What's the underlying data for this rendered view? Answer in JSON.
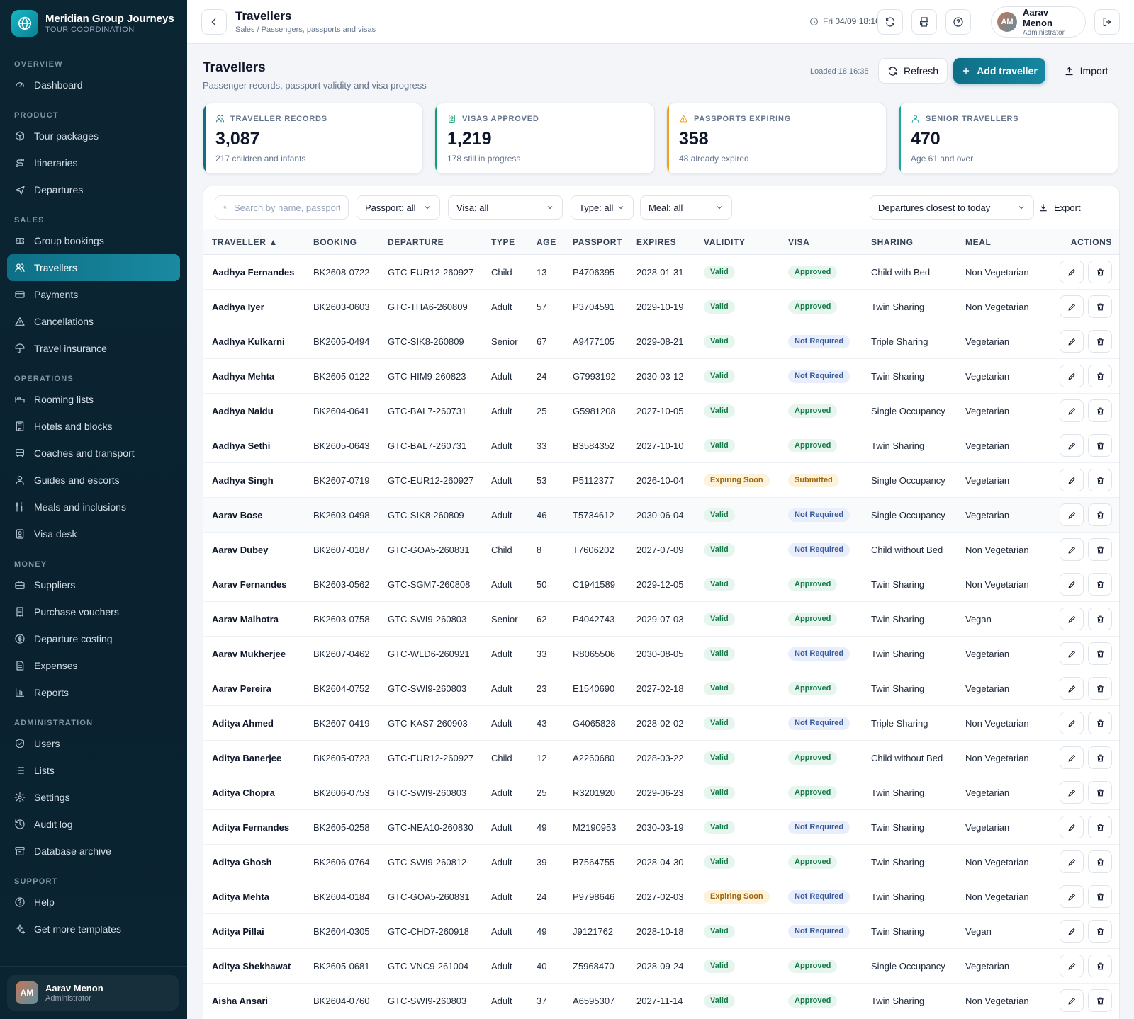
{
  "brand": {
    "name": "Meridian Group Journeys",
    "subtitle": "TOUR COORDINATION"
  },
  "sidebar": {
    "sections": [
      {
        "title": "OVERVIEW",
        "items": [
          {
            "label": "Dashboard",
            "icon": "gauge-icon"
          }
        ]
      },
      {
        "title": "PRODUCT",
        "items": [
          {
            "label": "Tour packages",
            "icon": "package-icon"
          },
          {
            "label": "Itineraries",
            "icon": "route-icon"
          },
          {
            "label": "Departures",
            "icon": "plane-icon"
          }
        ]
      },
      {
        "title": "SALES",
        "items": [
          {
            "label": "Group bookings",
            "icon": "ticket-icon"
          },
          {
            "label": "Travellers",
            "icon": "users-icon",
            "active": true
          },
          {
            "label": "Payments",
            "icon": "credit-card-icon"
          },
          {
            "label": "Cancellations",
            "icon": "warning-icon"
          },
          {
            "label": "Travel insurance",
            "icon": "umbrella-icon"
          }
        ]
      },
      {
        "title": "OPERATIONS",
        "items": [
          {
            "label": "Rooming lists",
            "icon": "bed-icon"
          },
          {
            "label": "Hotels and blocks",
            "icon": "building-icon"
          },
          {
            "label": "Coaches and transport",
            "icon": "bus-icon"
          },
          {
            "label": "Guides and escorts",
            "icon": "user-icon"
          },
          {
            "label": "Meals and inclusions",
            "icon": "utensils-icon"
          },
          {
            "label": "Visa desk",
            "icon": "passport-icon"
          }
        ]
      },
      {
        "title": "MONEY",
        "items": [
          {
            "label": "Suppliers",
            "icon": "briefcase-icon"
          },
          {
            "label": "Purchase vouchers",
            "icon": "receipt-icon"
          },
          {
            "label": "Departure costing",
            "icon": "coin-icon"
          },
          {
            "label": "Expenses",
            "icon": "file-text-icon"
          },
          {
            "label": "Reports",
            "icon": "bar-chart-icon"
          }
        ]
      },
      {
        "title": "ADMINISTRATION",
        "items": [
          {
            "label": "Users",
            "icon": "shield-icon"
          },
          {
            "label": "Lists",
            "icon": "list-icon"
          },
          {
            "label": "Settings",
            "icon": "gear-icon"
          },
          {
            "label": "Audit log",
            "icon": "history-icon"
          },
          {
            "label": "Database archive",
            "icon": "archive-icon"
          }
        ]
      },
      {
        "title": "SUPPORT",
        "items": [
          {
            "label": "Help",
            "icon": "help-icon"
          },
          {
            "label": "Get more templates",
            "icon": "sparkle-icon"
          }
        ]
      }
    ],
    "user": {
      "initials": "AM",
      "name": "Aarav Menon",
      "role": "Administrator"
    }
  },
  "topbar": {
    "title": "Travellers",
    "breadcrumb": "Sales / Passengers, passports and visas",
    "clock": "Fri 04/09 18:16",
    "user": {
      "initials": "AM",
      "name": "Aarav Menon",
      "role": "Administrator"
    }
  },
  "page": {
    "title": "Travellers",
    "subtitle": "Passenger records, passport validity and visa progress",
    "loaded": "Loaded 18:16:35",
    "refresh_label": "Refresh",
    "add_label": "Add traveller",
    "import_label": "Import"
  },
  "kpis": [
    {
      "label": "TRAVELLER RECORDS",
      "value": "3,087",
      "note": "217 children and infants",
      "accent": "#0e6f86",
      "icon": "users-icon"
    },
    {
      "label": "VISAS APPROVED",
      "value": "1,219",
      "note": "178 still in progress",
      "accent": "#12a070",
      "icon": "passport-icon"
    },
    {
      "label": "PASSPORTS EXPIRING",
      "value": "358",
      "note": "48 already expired",
      "accent": "#f0a020",
      "icon": "warning-icon"
    },
    {
      "label": "SENIOR TRAVELLERS",
      "value": "470",
      "note": "Age 61 and over",
      "accent": "#19a7a0",
      "icon": "user-icon"
    }
  ],
  "filters": {
    "search_placeholder": "Search by name, passport",
    "passport": "Passport: all",
    "visa": "Visa: all",
    "type": "Type: all",
    "meal": "Meal: all",
    "sort": "Departures closest to today",
    "export_label": "Export"
  },
  "table": {
    "columns": [
      "TRAVELLER ▲",
      "BOOKING",
      "DEPARTURE",
      "TYPE",
      "AGE",
      "PASSPORT",
      "EXPIRES",
      "VALIDITY",
      "VISA",
      "SHARING",
      "MEAL",
      "ACTIONS"
    ],
    "rows": [
      [
        "Aadhya Fernandes",
        "BK2608-0722",
        "GTC-EUR12-260927",
        "Child",
        "13",
        "P4706395",
        "2028-01-31",
        "Valid",
        "Approved",
        "Child with Bed",
        "Non Vegetarian"
      ],
      [
        "Aadhya Iyer",
        "BK2603-0603",
        "GTC-THA6-260809",
        "Adult",
        "57",
        "P3704591",
        "2029-10-19",
        "Valid",
        "Approved",
        "Twin Sharing",
        "Non Vegetarian"
      ],
      [
        "Aadhya Kulkarni",
        "BK2605-0494",
        "GTC-SIK8-260809",
        "Senior",
        "67",
        "A9477105",
        "2029-08-21",
        "Valid",
        "Not Required",
        "Triple Sharing",
        "Vegetarian"
      ],
      [
        "Aadhya Mehta",
        "BK2605-0122",
        "GTC-HIM9-260823",
        "Adult",
        "24",
        "G7993192",
        "2030-03-12",
        "Valid",
        "Not Required",
        "Twin Sharing",
        "Vegetarian"
      ],
      [
        "Aadhya Naidu",
        "BK2604-0641",
        "GTC-BAL7-260731",
        "Adult",
        "25",
        "G5981208",
        "2027-10-05",
        "Valid",
        "Approved",
        "Single Occupancy",
        "Vegetarian"
      ],
      [
        "Aadhya Sethi",
        "BK2605-0643",
        "GTC-BAL7-260731",
        "Adult",
        "33",
        "B3584352",
        "2027-10-10",
        "Valid",
        "Approved",
        "Twin Sharing",
        "Vegetarian"
      ],
      [
        "Aadhya Singh",
        "BK2607-0719",
        "GTC-EUR12-260927",
        "Adult",
        "53",
        "P5112377",
        "2026-10-04",
        "Expiring Soon",
        "Submitted",
        "Single Occupancy",
        "Vegetarian"
      ],
      [
        "Aarav Bose",
        "BK2603-0498",
        "GTC-SIK8-260809",
        "Adult",
        "46",
        "T5734612",
        "2030-06-04",
        "Valid",
        "Not Required",
        "Single Occupancy",
        "Vegetarian"
      ],
      [
        "Aarav Dubey",
        "BK2607-0187",
        "GTC-GOA5-260831",
        "Child",
        "8",
        "T7606202",
        "2027-07-09",
        "Valid",
        "Not Required",
        "Child without Bed",
        "Non Vegetarian"
      ],
      [
        "Aarav Fernandes",
        "BK2603-0562",
        "GTC-SGM7-260808",
        "Adult",
        "50",
        "C1941589",
        "2029-12-05",
        "Valid",
        "Approved",
        "Twin Sharing",
        "Non Vegetarian"
      ],
      [
        "Aarav Malhotra",
        "BK2603-0758",
        "GTC-SWI9-260803",
        "Senior",
        "62",
        "P4042743",
        "2029-07-03",
        "Valid",
        "Approved",
        "Twin Sharing",
        "Vegan"
      ],
      [
        "Aarav Mukherjee",
        "BK2607-0462",
        "GTC-WLD6-260921",
        "Adult",
        "33",
        "R8065506",
        "2030-08-05",
        "Valid",
        "Not Required",
        "Twin Sharing",
        "Vegetarian"
      ],
      [
        "Aarav Pereira",
        "BK2604-0752",
        "GTC-SWI9-260803",
        "Adult",
        "23",
        "E1540690",
        "2027-02-18",
        "Valid",
        "Approved",
        "Twin Sharing",
        "Vegetarian"
      ],
      [
        "Aditya Ahmed",
        "BK2607-0419",
        "GTC-KAS7-260903",
        "Adult",
        "43",
        "G4065828",
        "2028-02-02",
        "Valid",
        "Not Required",
        "Triple Sharing",
        "Non Vegetarian"
      ],
      [
        "Aditya Banerjee",
        "BK2605-0723",
        "GTC-EUR12-260927",
        "Child",
        "12",
        "A2260680",
        "2028-03-22",
        "Valid",
        "Approved",
        "Child without Bed",
        "Non Vegetarian"
      ],
      [
        "Aditya Chopra",
        "BK2606-0753",
        "GTC-SWI9-260803",
        "Adult",
        "25",
        "R3201920",
        "2029-06-23",
        "Valid",
        "Approved",
        "Twin Sharing",
        "Vegetarian"
      ],
      [
        "Aditya Fernandes",
        "BK2605-0258",
        "GTC-NEA10-260830",
        "Adult",
        "49",
        "M2190953",
        "2030-03-19",
        "Valid",
        "Not Required",
        "Twin Sharing",
        "Vegetarian"
      ],
      [
        "Aditya Ghosh",
        "BK2606-0764",
        "GTC-SWI9-260812",
        "Adult",
        "39",
        "B7564755",
        "2028-04-30",
        "Valid",
        "Approved",
        "Twin Sharing",
        "Non Vegetarian"
      ],
      [
        "Aditya Mehta",
        "BK2604-0184",
        "GTC-GOA5-260831",
        "Adult",
        "24",
        "P9798646",
        "2027-02-03",
        "Expiring Soon",
        "Not Required",
        "Twin Sharing",
        "Non Vegetarian"
      ],
      [
        "Aditya Pillai",
        "BK2604-0305",
        "GTC-CHD7-260918",
        "Adult",
        "49",
        "J9121762",
        "2028-10-18",
        "Valid",
        "Not Required",
        "Twin Sharing",
        "Vegan"
      ],
      [
        "Aditya Shekhawat",
        "BK2605-0681",
        "GTC-VNC9-261004",
        "Adult",
        "40",
        "Z5968470",
        "2028-09-24",
        "Valid",
        "Approved",
        "Single Occupancy",
        "Vegetarian"
      ],
      [
        "Aisha Ansari",
        "BK2604-0760",
        "GTC-SWI9-260803",
        "Adult",
        "37",
        "A6595307",
        "2027-11-14",
        "Valid",
        "Approved",
        "Twin Sharing",
        "Non Vegetarian"
      ]
    ]
  },
  "colors": {
    "accent": "#0e6f86",
    "sidebar_bg": "#0b2431"
  }
}
